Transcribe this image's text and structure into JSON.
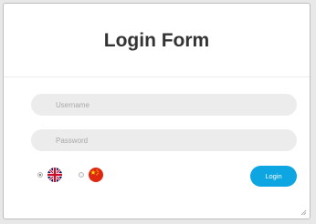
{
  "form": {
    "title": "Login Form",
    "username_placeholder": "Username",
    "password_placeholder": "Password",
    "login_label": "Login"
  },
  "languages": [
    {
      "code": "en",
      "icon": "uk-flag-icon",
      "selected": true
    },
    {
      "code": "zh",
      "icon": "china-flag-icon",
      "selected": false
    }
  ],
  "colors": {
    "accent": "#0ea5e3",
    "field_bg": "#ececec",
    "title": "#333333",
    "china_red": "#de2910",
    "china_yellow": "#ffde00",
    "uk_blue": "#012169",
    "uk_red": "#c8102e"
  }
}
